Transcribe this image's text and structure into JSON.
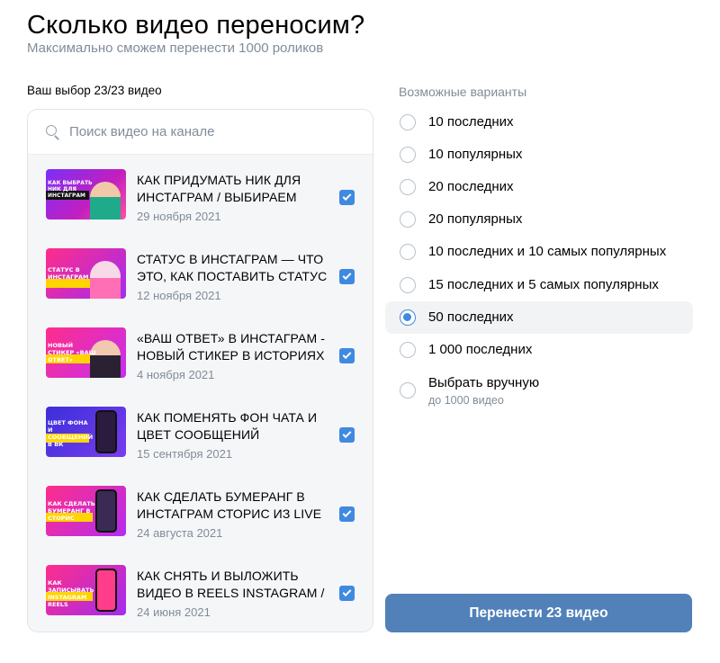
{
  "header": {
    "title": "Сколько видео переносим?",
    "subtitle": "Максимально сможем перенести 1000 роликов"
  },
  "selection": {
    "label": "Ваш выбор 23/23 видео"
  },
  "search": {
    "placeholder": "Поиск видео на канале",
    "value": ""
  },
  "videos": [
    {
      "title": "Как придумать ник для Инстаграм / Выбираем",
      "date": "29 ноября 2021",
      "checked": true,
      "thumb_text": "КАК ВЫБРАТЬ НИК ДЛЯ ИНСТАГРАМ"
    },
    {
      "title": "Статус в Инстаграм — что это, как поставить статус",
      "date": "12 ноября 2021",
      "checked": true,
      "thumb_text": "СТАТУС В ИНСТАГРАМ"
    },
    {
      "title": "«Ваш ответ» в Инстаграм - новый стикер в историях",
      "date": "4 ноября 2021",
      "checked": true,
      "thumb_text": "НОВЫЙ СТИКЕР «ВАШ ОТВЕТ»"
    },
    {
      "title": "Как поменять фон чата и цвет сообщений",
      "date": "15 сентября 2021",
      "checked": true,
      "thumb_text": "ЦВЕТ ФОНА И СООБЩЕНИЙ В ВК"
    },
    {
      "title": "Как сделать бумеранг в Инстаграм сторис из Live",
      "date": "24 августа 2021",
      "checked": true,
      "thumb_text": "КАК СДЕЛАТЬ БУМЕРАНГ В СТОРИС"
    },
    {
      "title": "Как снять и выложить видео в Reels Instagram /",
      "date": "24 июня 2021",
      "checked": true,
      "thumb_text": "КАК ЗАПИСЫВАТЬ INSTAGRAM REELS"
    }
  ],
  "options": {
    "label": "Возможные варианты",
    "items": [
      {
        "label": "10 последних",
        "selected": false
      },
      {
        "label": "10 популярных",
        "selected": false
      },
      {
        "label": "20 последних",
        "selected": false
      },
      {
        "label": "20 популярных",
        "selected": false
      },
      {
        "label": "10 последних и 10 самых популярных",
        "selected": false
      },
      {
        "label": "15 последних и 5 самых популярных",
        "selected": false
      },
      {
        "label": "50 последних",
        "selected": true
      },
      {
        "label": "1 000 последних",
        "selected": false
      },
      {
        "label": "Выбрать вручную",
        "hint": "до 1000 видео",
        "selected": false
      }
    ]
  },
  "submit": {
    "label": "Перенести 23 видео"
  },
  "colors": {
    "accent": "#3f8ae0",
    "button": "#5181b8",
    "muted_text": "#818c99",
    "list_bg": "#f5f6f8"
  }
}
